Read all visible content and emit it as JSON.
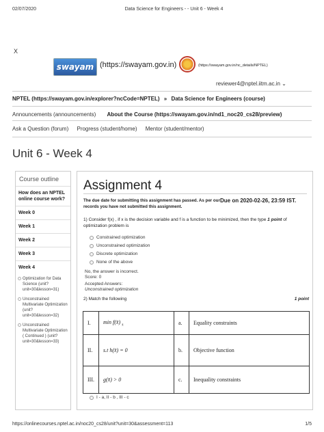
{
  "print_header": {
    "date": "02/07/2020",
    "title": "Data Science for Engineers - - Unit 6 - Week 4"
  },
  "print_footer": {
    "url": "https://onlinecourses.nptel.ac.in/noc20_cs28/unit?unit=30&assessment=113",
    "page": "1/5"
  },
  "header": {
    "close": "X",
    "swayam_logo": "swayam",
    "swayam_link": "(https://swayam.gov.in)",
    "nptel_link": "(https://swayam.gov.in/nc_details/NPTEL)",
    "user": "reviewer4@nptel.iitm.ac.in",
    "user_caret": "⌄"
  },
  "nav": {
    "breadcrumb_nptel": "NPTEL (https://swayam.gov.in/explorer?ncCode=NPTEL)",
    "breadcrumb_sep": "»",
    "breadcrumb_course": "Data Science for Engineers (course)",
    "announcements": "Announcements (announcements)",
    "about": "About the Course (https://swayam.gov.in/nd1_noc20_cs28/preview)",
    "ask": "Ask a Question (forum)",
    "progress": "Progress (student/home)",
    "mentor": "Mentor (student/mentor)"
  },
  "unit_title": "Unit 6 - Week 4",
  "sidebar": {
    "heading": "Course outline",
    "items": [
      "How does an NPTEL online course work?",
      "Week 0",
      "Week 1",
      "Week 2",
      "Week 3",
      "Week 4"
    ],
    "sub_items": [
      "Optimization for Data Science (unit?unit=30&lesson=31)",
      "Unconstrained Multivariate Optimization (unit?unit=30&lesson=32)",
      "Unconstrained Multivariate Optimization ( Continued ) (unit?unit=30&lesson=33)"
    ]
  },
  "assignment": {
    "title": "Assignment 4",
    "due_note": "The due date for submitting this assignment has passed. As per our records you have not submitted this assignment.",
    "due_date": "Due on 2020-02-26, 23:59 IST.",
    "q1": {
      "text_before": "1) Consider f(x) , if x is the decision variable and f is a function to be minimized, then the type",
      "points": "1 point",
      "text_after": "of optimization problem is",
      "options": [
        "Constrained optimization",
        "Unconstrained optimization",
        "Discrete optimization",
        "None of the above"
      ],
      "result": "No, the answer is incorrect.",
      "score": "Score: 0",
      "accepted_label": "Accepted Answers:",
      "accepted_answer": "Unconstrained optimization"
    },
    "q2": {
      "text": "2) Match the following",
      "points": "1 point",
      "rows": [
        {
          "num": "I.",
          "expr": "min f(x̄)",
          "expr_sub": "x̄",
          "letter": "a.",
          "desc": "Equality constraints"
        },
        {
          "num": "II.",
          "expr": "s.t h(x̄) = 0",
          "expr_sub": "",
          "letter": "b.",
          "desc": "Objective function"
        },
        {
          "num": "III.",
          "expr": "g(x̄) > 0",
          "expr_sub": "",
          "letter": "c.",
          "desc": "Inequality constraints"
        }
      ],
      "first_option": "I - a, II - b , III - c"
    }
  }
}
